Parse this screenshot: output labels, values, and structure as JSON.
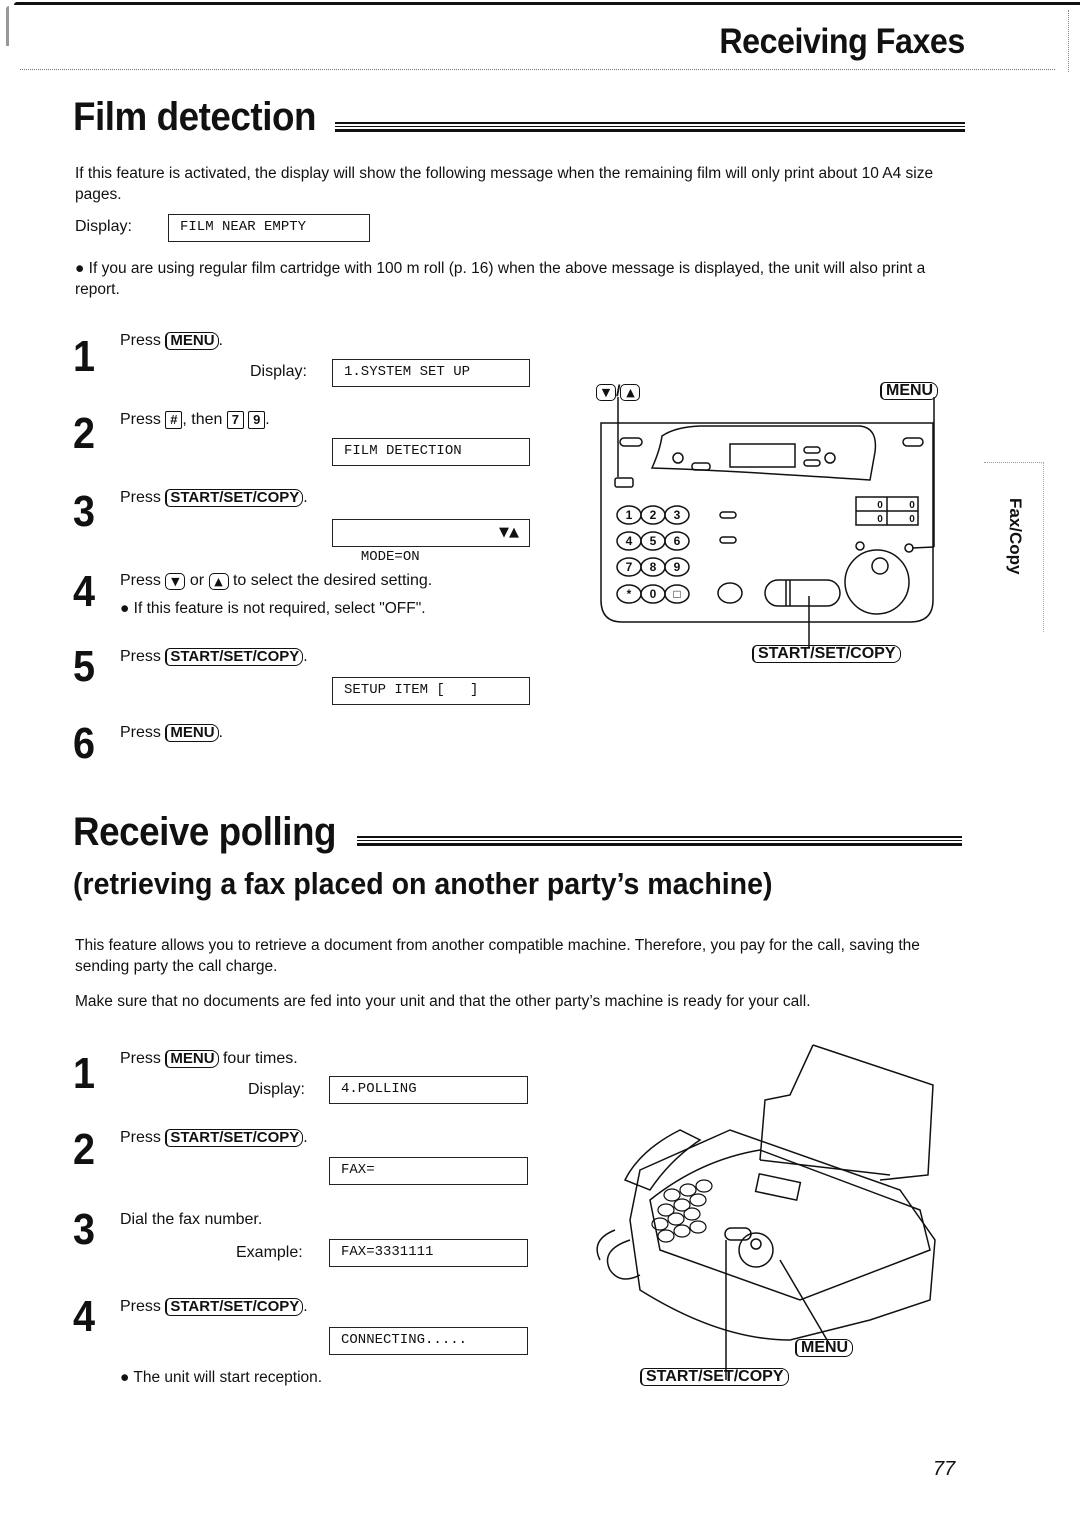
{
  "header": {
    "title": "Receiving Faxes"
  },
  "side_tab": {
    "label": "Fax/Copy"
  },
  "film_detection": {
    "title": "Film detection",
    "intro": "If this feature is activated, the display will show the following message when the remaining film will only print about 10 A4 size pages.",
    "display_label": "Display:",
    "display_value": "FILM NEAR EMPTY",
    "bullet": "If you are using regular film cartridge with 100 m roll (p. 16) when the above message is displayed, the unit will also print a report.",
    "steps": [
      {
        "num": "1",
        "press": "Press",
        "key": "MENU",
        "after": ".",
        "display_label": "Display:",
        "display": "1.SYSTEM SET UP"
      },
      {
        "num": "2",
        "press": "Press",
        "key1": "#",
        "mid": ", then",
        "key2": "7",
        "key3": "9",
        "after": ".",
        "display": "FILM DETECTION"
      },
      {
        "num": "3",
        "press": "Press",
        "key": "START/SET/COPY",
        "after": ".",
        "display": "MODE=ON",
        "display_arrows": "▼▲"
      },
      {
        "num": "4",
        "press": "Press",
        "key1": "▼",
        "mid": "or",
        "key2": "▲",
        "after": "to select the desired setting.",
        "note": "If this feature is not required, select \"OFF\"."
      },
      {
        "num": "5",
        "press": "Press",
        "key": "START/SET/COPY",
        "after": ".",
        "display": "SETUP ITEM [   ]"
      },
      {
        "num": "6",
        "press": "Press",
        "key": "MENU",
        "after": "."
      }
    ],
    "diagram": {
      "callout_arrows": "▼/▲",
      "callout_down": "▼",
      "callout_sep": "/",
      "callout_up": "▲",
      "callout_menu": "MENU",
      "callout_start": "START/SET/COPY",
      "keypad": [
        "1",
        "2",
        "3",
        "4",
        "5",
        "6",
        "7",
        "8",
        "9",
        "*",
        "0",
        "□"
      ],
      "counter": [
        "0",
        "0",
        "0",
        "0"
      ]
    }
  },
  "receive_polling": {
    "title": "Receive polling",
    "subtitle": "(retrieving a fax placed on another party’s machine)",
    "para1": "This feature allows you to retrieve a document from another compatible machine. Therefore, you pay for the call, saving the sending party the call charge.",
    "para2": "Make sure that no documents are fed into your unit and that the other party’s machine is ready for your call.",
    "steps": [
      {
        "num": "1",
        "press": "Press",
        "key": "MENU",
        "after": "four times.",
        "display_label": "Display:",
        "display": "4.POLLING"
      },
      {
        "num": "2",
        "press": "Press",
        "key": "START/SET/COPY",
        "after": ".",
        "display": "FAX="
      },
      {
        "num": "3",
        "text": "Dial the fax number.",
        "display_label": "Example:",
        "display": "FAX=3331111"
      },
      {
        "num": "4",
        "press": "Press",
        "key": "START/SET/COPY",
        "after": ".",
        "display": "CONNECTING.....",
        "note": "The unit will start reception."
      }
    ],
    "diagram": {
      "callout_menu": "MENU",
      "callout_start": "START/SET/COPY"
    }
  },
  "page_number": "77"
}
